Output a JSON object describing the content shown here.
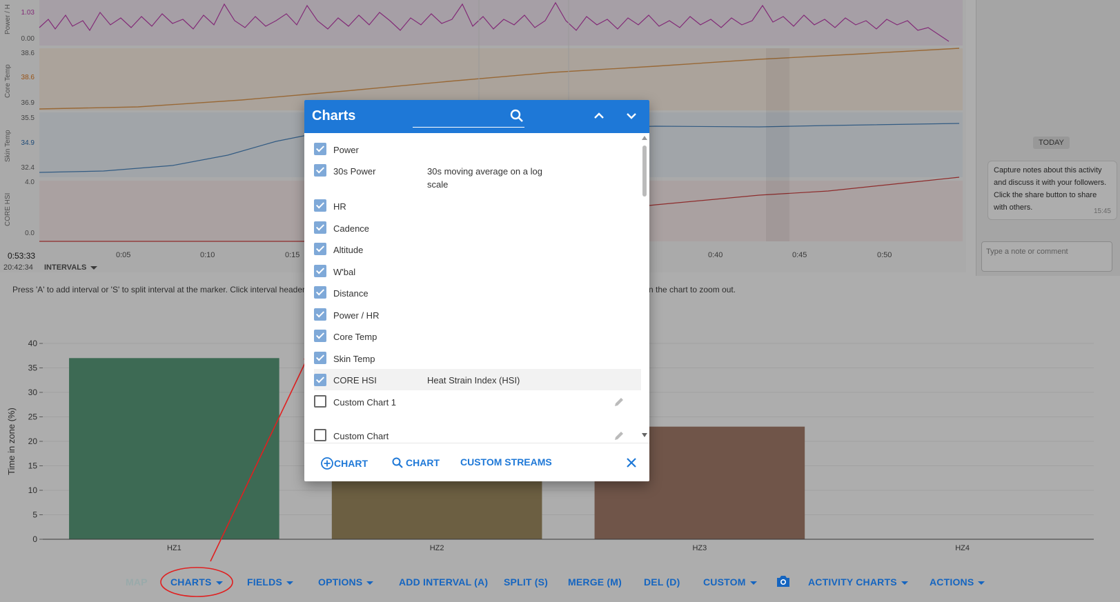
{
  "top_charts": {
    "power_hr": {
      "label": "Power / H",
      "max": "1.03",
      "min": "0.00"
    },
    "core_temp": {
      "label": "Core Temp",
      "max": "38.6",
      "marker": "38.6",
      "min": "36.9"
    },
    "skin_temp": {
      "label": "Skin Temp",
      "max": "35.5",
      "marker": "34.9",
      "min": "32.4"
    },
    "core_hsi": {
      "label": "CORE HSI",
      "max": "4.0",
      "min": "0.0"
    },
    "x_ticks": [
      "0:05",
      "0:10",
      "0:15",
      "0:40",
      "0:45",
      "0:50"
    ],
    "time_cursor": "0:53:33",
    "clock": "20:42:34",
    "intervals_label": "INTERVALS"
  },
  "hint_text": {
    "left": "Press 'A' to add interval or 'S' to split interval at the marker. Click interval header",
    "right": "n the chart to zoom out."
  },
  "notes_panel": {
    "today_label": "TODAY",
    "note_text": "Capture notes about this activity and discuss it with your followers. Click the share button to share with others.",
    "note_time": "15:45",
    "input_placeholder": "Type a note or comment"
  },
  "chart_data": {
    "type": "bar",
    "categories": [
      "HZ1",
      "HZ2",
      "HZ3",
      "HZ4"
    ],
    "values": [
      37,
      20,
      23,
      0
    ],
    "ylabel": "Time in zone (%)",
    "ylim": [
      0,
      40
    ],
    "yticks": [
      "0",
      "5",
      "10",
      "15",
      "20",
      "25",
      "30",
      "35",
      "40"
    ],
    "colors": [
      "#5a9d7c",
      "#a08c62",
      "#a57e6c",
      "#bbbbbb"
    ]
  },
  "toolbar": {
    "map": "MAP",
    "charts": "CHARTS",
    "fields": "FIELDS",
    "options": "OPTIONS",
    "add_interval": "ADD INTERVAL (A)",
    "split": "SPLIT (S)",
    "merge": "MERGE (M)",
    "del": "DEL (D)",
    "custom": "CUSTOM",
    "activity_charts": "ACTIVITY CHARTS",
    "actions": "ACTIONS"
  },
  "dialog": {
    "title": "Charts",
    "search_value": "",
    "items": [
      {
        "label": "Power",
        "desc": "",
        "checked": true
      },
      {
        "label": "30s Power",
        "desc": "30s moving average on a log scale",
        "checked": true
      },
      {
        "label": "HR",
        "desc": "",
        "checked": true
      },
      {
        "label": "Cadence",
        "desc": "",
        "checked": true
      },
      {
        "label": "Altitude",
        "desc": "",
        "checked": true
      },
      {
        "label": "W'bal",
        "desc": "",
        "checked": true
      },
      {
        "label": "Distance",
        "desc": "",
        "checked": true
      },
      {
        "label": "Power / HR",
        "desc": "",
        "checked": true
      },
      {
        "label": "Core Temp",
        "desc": "",
        "checked": true
      },
      {
        "label": "Skin Temp",
        "desc": "",
        "checked": true
      },
      {
        "label": "CORE HSI",
        "desc": "Heat Strain Index (HSI)",
        "checked": true
      },
      {
        "label": "Custom Chart 1",
        "desc": "",
        "checked": false
      },
      {
        "label": "Custom Chart",
        "desc": "",
        "checked": false
      }
    ],
    "footer": {
      "add_chart": "CHART",
      "find_chart": "CHART",
      "custom_streams": "CUSTOM STREAMS"
    }
  },
  "colors": {
    "accent": "#1e78d7",
    "annotation": "#e02020",
    "power_series": "#c040b0",
    "core_temp_series": "#e09a50",
    "skin_temp_series": "#4a86c0",
    "hsi_series": "#d04040"
  }
}
